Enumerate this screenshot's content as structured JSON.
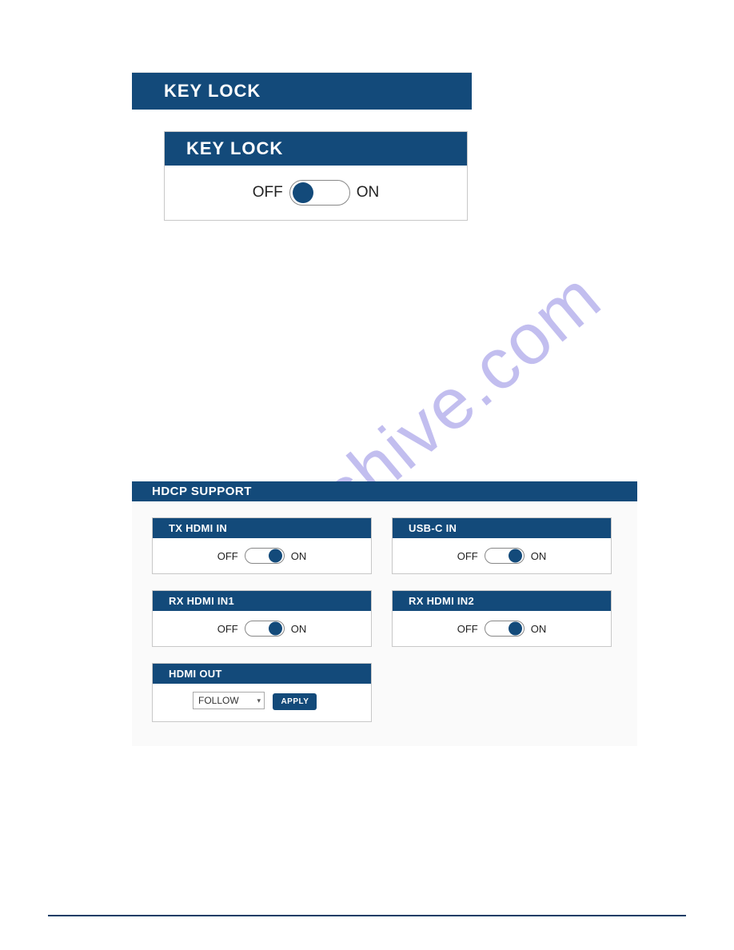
{
  "watermark": "manualshive.com",
  "section1": {
    "title": "KEY LOCK",
    "card": {
      "title": "KEY LOCK",
      "off": "OFF",
      "on": "ON",
      "state": "off"
    }
  },
  "section2": {
    "title": "HDCP SUPPORT",
    "cards": {
      "tx_hdmi_in": {
        "title": "TX HDMI IN",
        "off": "OFF",
        "on": "ON",
        "state": "on"
      },
      "usb_c_in": {
        "title": "USB-C IN",
        "off": "OFF",
        "on": "ON",
        "state": "on"
      },
      "rx_hdmi_in1": {
        "title": "RX HDMI IN1",
        "off": "OFF",
        "on": "ON",
        "state": "on"
      },
      "rx_hdmi_in2": {
        "title": "RX HDMI IN2",
        "off": "OFF",
        "on": "ON",
        "state": "on"
      },
      "hdmi_out": {
        "title": "HDMI OUT",
        "select_value": "FOLLOW",
        "apply_label": "APPLY"
      }
    }
  }
}
